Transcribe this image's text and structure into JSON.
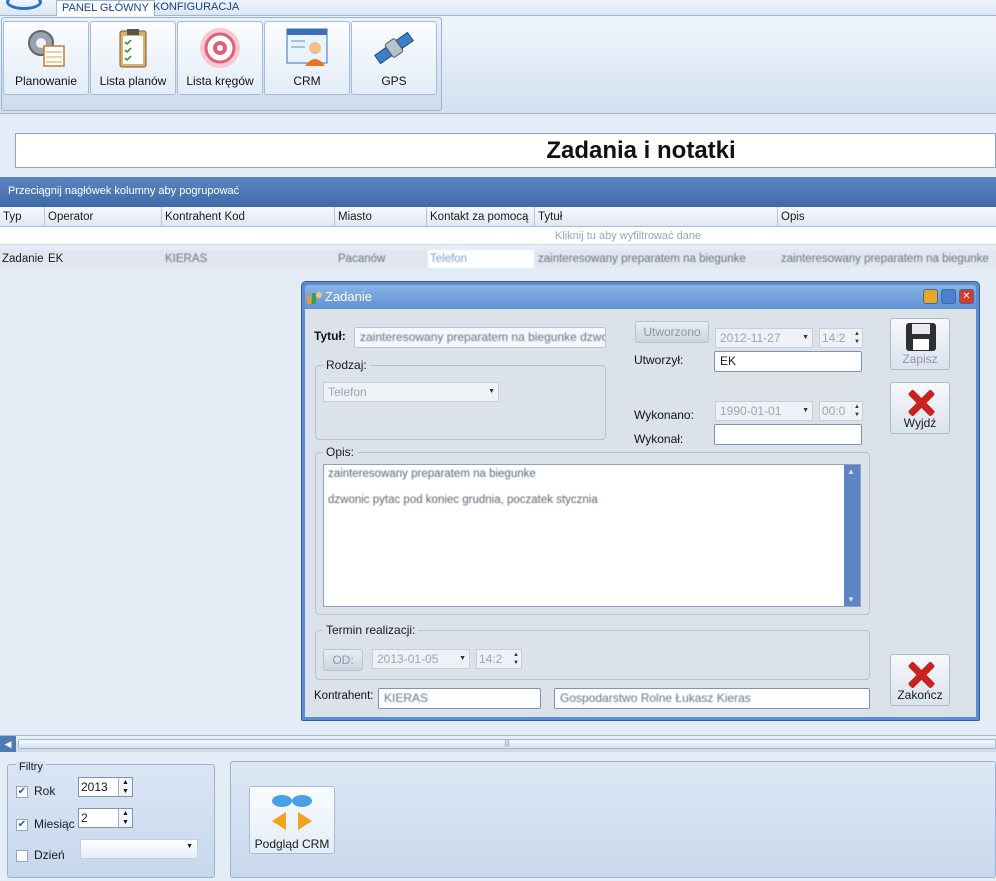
{
  "ribbon": {
    "tabs": [
      {
        "label": "PANEL GŁÓWNY"
      },
      {
        "label": "KONFIGURACJA"
      }
    ],
    "buttons": [
      {
        "label": "Planowanie",
        "icon": "planning-gear-icon"
      },
      {
        "label": "Lista planów",
        "icon": "clipboard-checklist-icon"
      },
      {
        "label": "Lista kręgów",
        "icon": "target-circles-icon"
      },
      {
        "label": "CRM",
        "icon": "crm-user-icon"
      },
      {
        "label": "GPS",
        "icon": "satellite-icon"
      }
    ]
  },
  "page": {
    "title": "Zadania i notatki"
  },
  "grid": {
    "group_hint": "Przeciągnij nagłówek kolumny aby pogrupować",
    "columns": [
      "Typ",
      "Operator",
      "Kontrahent Kod",
      "Miasto",
      "Kontakt za pomocą",
      "Tytuł",
      "Opis"
    ],
    "filter_hint": "Kliknij tu aby wyfiltrować dane",
    "rows": [
      {
        "typ": "Zadanie",
        "operator": "EK",
        "kod": "KIERAS",
        "miasto": "Pacanów",
        "kontakt": "Telefon",
        "tytul": "zainteresowany preparatem na biegunke",
        "opis": "zainteresowany preparatem na biegunke"
      }
    ]
  },
  "dialog": {
    "title": "Zadanie",
    "tytul_label": "Tytuł:",
    "tytul_value": "zainteresowany preparatem na biegunke dzwonic",
    "rodzaj_label": "Rodzaj:",
    "rodzaj_value": "Telefon",
    "utworzono_button": "Utworzono",
    "utworzono_date": "2012-11-27",
    "utworzono_time": "14:2",
    "utworzyl_label": "Utworzył:",
    "utworzyl_value": "EK",
    "wykonano_label": "Wykonano:",
    "wykonano_date": "1990-01-01",
    "wykonano_time": "00:0",
    "wykonal_label": "Wykonał:",
    "wykonal_value": "",
    "opis_label": "Opis:",
    "opis_lines": [
      "zainteresowany preparatem na biegunke",
      "dzwonic pytac pod koniec grudnia, poczatek stycznia"
    ],
    "termin_label": "Termin realizacji:",
    "od_button": "OD:",
    "termin_date": "2013-01-05",
    "termin_time": "14:2",
    "kontrahent_label": "Kontrahent:",
    "kontrahent_code": "KIERAS",
    "kontrahent_name": "Gospodarstwo Rolne Łukasz Kieras",
    "buttons": {
      "save": "Zapisz",
      "exit": "Wyjdź",
      "finish": "Zakończ"
    }
  },
  "filters": {
    "title": "Filtry",
    "rok_label": "Rok",
    "rok_value": "2013",
    "miesiac_label": "Miesiąc",
    "miesiac_value": "2",
    "dzien_label": "Dzień",
    "dzien_value": ""
  },
  "preview": {
    "button_label": "Podgląd CRM",
    "icon": "crm-preview-icon"
  },
  "colors": {
    "accent_blue": "#3f6aa8",
    "close_red": "#cc2121",
    "dialog_frame": "#5a8ed0"
  }
}
